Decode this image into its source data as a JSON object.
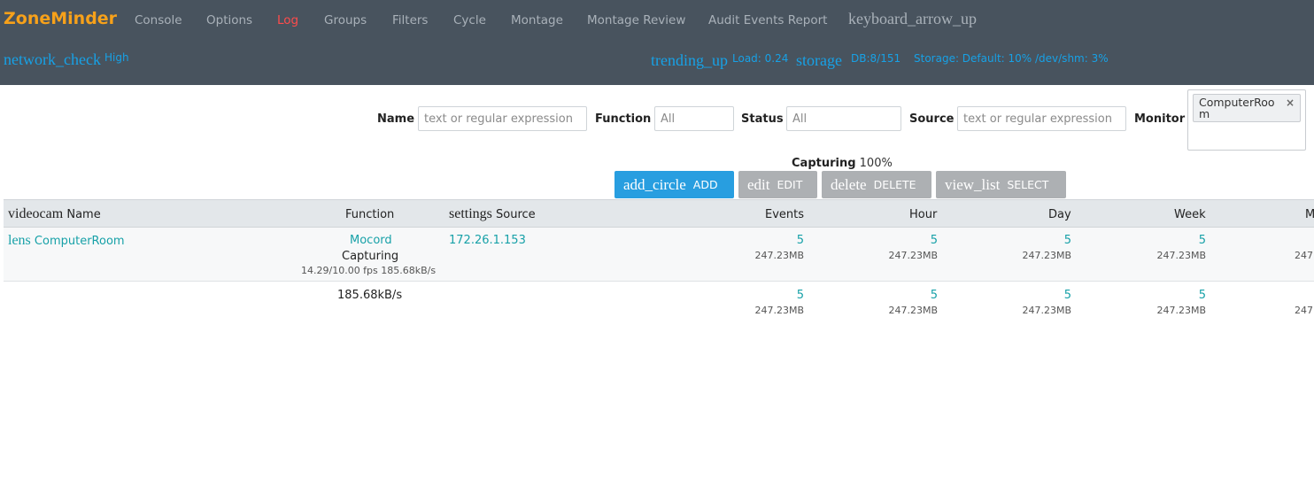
{
  "header": {
    "brand": "ZoneMinder",
    "nav": [
      "Console",
      "Options",
      "Log",
      "Groups",
      "Filters",
      "Cycle",
      "Montage",
      "Montage Review",
      "Audit Events Report"
    ],
    "active_nav": "Log",
    "nav_toggle_icon": "keyboard_arrow_up",
    "network_icon": "network_check",
    "network_level": "High",
    "load_icon": "trending_up",
    "load": "Load: 0.24",
    "storage_icon": "storage",
    "db": "DB:8/151",
    "storage": "Storage: Default: 10% /dev/shm: 3%"
  },
  "filters": {
    "name_label": "Name",
    "name_placeholder": "text or regular expression",
    "function_label": "Function",
    "function_placeholder": "All",
    "status_label": "Status",
    "status_placeholder": "All",
    "source_label": "Source",
    "source_placeholder": "text or regular expression",
    "monitor_label": "Monitor",
    "monitor_selected": "ComputerRoom",
    "monitor_remove": "×"
  },
  "summary": {
    "label": "Capturing",
    "value": "100%"
  },
  "toolbar": {
    "add_icon": "add_circle",
    "add_label": "ADD",
    "edit_icon": "edit",
    "edit_label": "EDIT",
    "delete_icon": "delete",
    "delete_label": "DELETE",
    "select_icon": "view_list",
    "select_label": "SELECT"
  },
  "table": {
    "headers": {
      "name_icon": "videocam",
      "name": "Name",
      "function": "Function",
      "source_icon": "settings",
      "source": "Source",
      "events": "Events",
      "hour": "Hour",
      "day": "Day",
      "week": "Week",
      "month": "M"
    },
    "rows": [
      {
        "icon": "lens",
        "name": "ComputerRoom",
        "function": "Mocord",
        "status": "Capturing",
        "stats": "14.29/10.00 fps 185.68kB/s",
        "source": "172.26.1.153",
        "events": "5",
        "events_size": "247.23MB",
        "hour": "5",
        "hour_size": "247.23MB",
        "day": "5",
        "day_size": "247.23MB",
        "week": "5",
        "week_size": "247.23MB",
        "month_size": "247."
      }
    ],
    "totals": {
      "bandwidth": "185.68kB/s",
      "events": "5",
      "events_size": "247.23MB",
      "hour": "5",
      "hour_size": "247.23MB",
      "day": "5",
      "day_size": "247.23MB",
      "week": "5",
      "week_size": "247.23MB",
      "month_size": "247."
    }
  },
  "colors": {
    "header_bg": "#48535e",
    "brand": "#f7a11a",
    "nav_text": "#a9b1b9",
    "nav_active": "#ff4b4b",
    "link": "#17a1e6",
    "primary_button": "#289ee0",
    "secondary_button": "#adb0b3"
  }
}
